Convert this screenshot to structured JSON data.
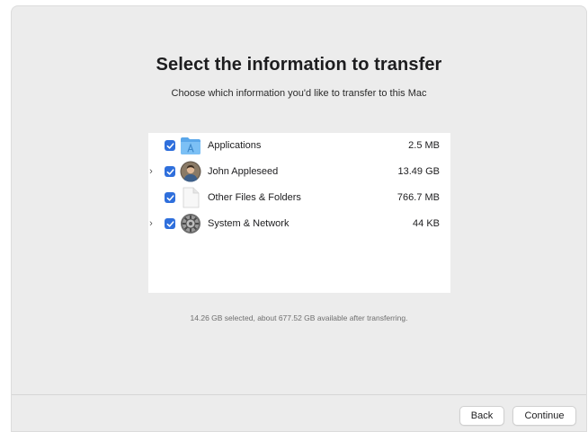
{
  "window": {
    "title": "Select the information to transfer",
    "subtitle": "Choose which information you'd like to transfer to this Mac"
  },
  "items": [
    {
      "label": "Applications",
      "size": "2.5 MB",
      "checked": true,
      "expandable": false,
      "icon": "applications-folder-icon"
    },
    {
      "label": "John Appleseed",
      "size": "13.49 GB",
      "checked": true,
      "expandable": true,
      "icon": "user-avatar-icon"
    },
    {
      "label": "Other Files & Folders",
      "size": "766.7 MB",
      "checked": true,
      "expandable": false,
      "icon": "document-icon"
    },
    {
      "label": "System & Network",
      "size": "44 KB",
      "checked": true,
      "expandable": true,
      "icon": "system-preferences-icon"
    }
  ],
  "status": "14.26 GB selected, about 677.52 GB available after transferring.",
  "buttons": {
    "back": "Back",
    "continue": "Continue"
  },
  "colors": {
    "accent": "#2f6fdc",
    "window_bg": "#ececec",
    "folder_blue": "#6cb6f2"
  }
}
